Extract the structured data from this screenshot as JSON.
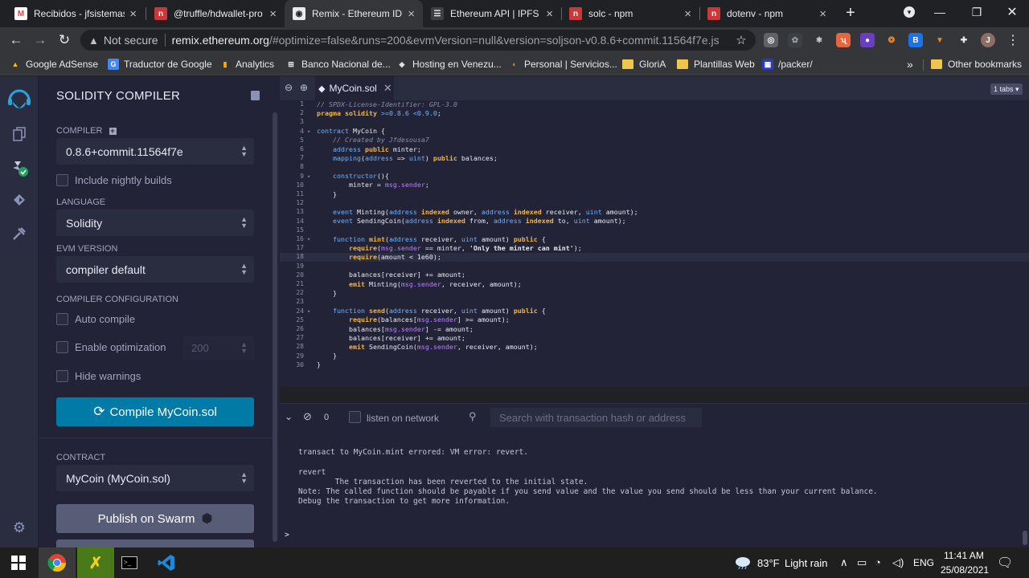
{
  "browser": {
    "tabs": [
      {
        "label": "Recibidos - jfsistemas",
        "icon": "gmail-icon",
        "color": "#ea4335"
      },
      {
        "label": "@truffle/hdwallet-pro",
        "icon": "npm-icon",
        "color": "#cb3837"
      },
      {
        "label": "Remix - Ethereum IDE",
        "icon": "remix-icon",
        "color": "#0f1117"
      },
      {
        "label": "Ethereum API | IPFS A",
        "icon": "infura-icon",
        "color": "#444444"
      },
      {
        "label": "solc - npm",
        "icon": "npm-icon",
        "color": "#cb3837"
      },
      {
        "label": "dotenv - npm",
        "icon": "npm-icon",
        "color": "#cb3837"
      }
    ],
    "address": {
      "security": "Not secure",
      "host": "remix.ethereum.org",
      "path": "/#optimize=false&runs=200&evmVersion=null&version=soljson-v0.8.6+commit.11564f7e.js"
    },
    "bookmarks": [
      {
        "label": "Google AdSense",
        "icon": "adsense-icon"
      },
      {
        "label": "Traductor de Google",
        "icon": "translate-icon"
      },
      {
        "label": "Analytics",
        "icon": "analytics-icon"
      },
      {
        "label": "Banco Nacional de...",
        "icon": "bank-icon"
      },
      {
        "label": "Hosting en Venezu...",
        "icon": "hosting-icon"
      },
      {
        "label": "Personal | Servicios...",
        "icon": "personal-icon"
      },
      {
        "label": "GloriA",
        "icon": "folder-icon"
      },
      {
        "label": "Plantillas Web",
        "icon": "folder-icon"
      },
      {
        "label": "/packer/",
        "icon": "packer-icon"
      }
    ],
    "bookmarks_overflow": "»",
    "other_bookmarks": "Other bookmarks",
    "extension_badge": "13"
  },
  "sidepanel": {
    "title": "SOLIDITY COMPILER",
    "compiler_label": "COMPILER",
    "compiler_value": "0.8.6+commit.11564f7e",
    "nightly_label": "Include nightly builds",
    "language_label": "LANGUAGE",
    "language_value": "Solidity",
    "evm_label": "EVM VERSION",
    "evm_value": "compiler default",
    "config_label": "COMPILER CONFIGURATION",
    "auto_compile": "Auto compile",
    "enable_opt": "Enable optimization",
    "runs_value": "200",
    "hide_warnings": "Hide warnings",
    "compile_button": "Compile MyCoin.sol",
    "contract_label": "CONTRACT",
    "contract_value": "MyCoin (MyCoin.sol)",
    "publish_button": "Publish on Swarm"
  },
  "editor": {
    "file_tab": "MyCoin.sol",
    "tabs_badge": "1 tabs",
    "line_count": 30
  },
  "terminal": {
    "count": "0",
    "listen_label": "listen on network",
    "search_placeholder": "Search with transaction hash or address",
    "lines": [
      "transact to MyCoin.mint errored: VM error: revert.",
      "revert",
      "        The transaction has been reverted to the initial state.",
      "Note: The called function should be payable if you send value and the value you send should be less than your current balance.",
      "Debug the transaction to get more information."
    ],
    "prompt": ">"
  },
  "taskbar": {
    "weather_temp": "83°F",
    "weather_desc": "Light rain",
    "language": "ENG",
    "time": "11:41 AM",
    "date": "25/08/2021"
  }
}
